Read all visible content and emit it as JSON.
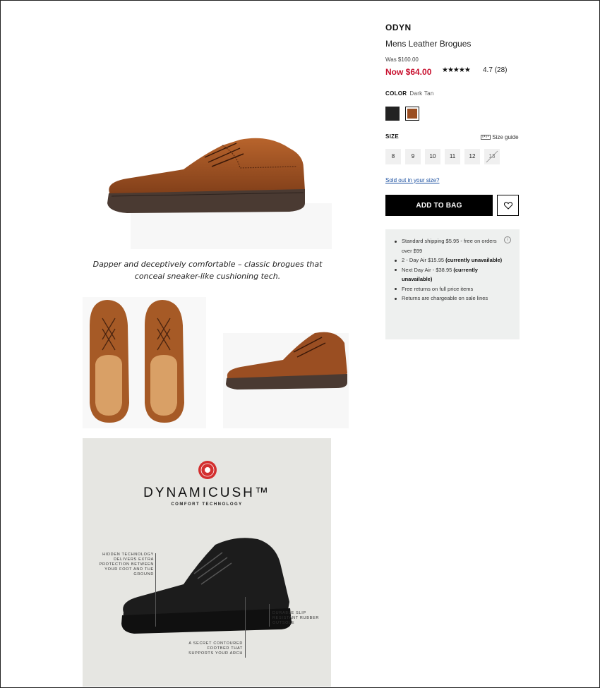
{
  "product": {
    "brand": "ODYN",
    "name": "Mens Leather Brogues",
    "was_price": "Was $160.00",
    "now_price": "Now $64.00",
    "rating_stars": "★★★★★",
    "rating": "4.7",
    "review_count": "(28)",
    "rating_value": 4.7
  },
  "color": {
    "label": "COLOR",
    "selected": "Dark Tan",
    "swatches": [
      {
        "name": "Black",
        "hex": "#222222"
      },
      {
        "name": "Dark Tan",
        "hex": "#9a4e22"
      }
    ]
  },
  "size": {
    "label": "SIZE",
    "guide": "Size guide",
    "options": [
      "8",
      "9",
      "10",
      "11",
      "12",
      "13"
    ],
    "unavailable": [
      "13"
    ]
  },
  "sold_out_link": "Sold out in your size?",
  "add_to_bag": "ADD TO BAG",
  "shipping": {
    "items": [
      {
        "text": "Standard shipping $5.95 - free on orders over $99",
        "bold": ""
      },
      {
        "text": "2 - Day Air $15.95 ",
        "bold": "(currently unavailable)"
      },
      {
        "text": "Next Day Air -  $38.95 ",
        "bold": "(currently unavailable)"
      },
      {
        "text": "Free returns on full price items",
        "bold": ""
      },
      {
        "text": "Returns are chargeable on sale lines",
        "bold": ""
      }
    ]
  },
  "tagline": "Dapper and deceptively comfortable – classic brogues that conceal sneaker-like cushioning tech.",
  "dynamicush": {
    "title": "DYNAMICUSH™",
    "subtitle": "COMFORT TECHNOLOGY",
    "note_left": "HIDDEN TECHNOLOGY DELIVERS EXTRA PROTECTION BETWEEN YOUR FOOT AND THE GROUND",
    "note_right": "DURABLE SLIP RESISTANT RUBBER OUTSOLE",
    "note_bottom": "A SECRET CONTOURED FOOTBED THAT SUPPORTS YOUR ARCH"
  },
  "colors": {
    "sale_red": "#c8102e",
    "button_black": "#000000",
    "link_blue": "#1a4fa0",
    "shipping_bg": "#eef0ef",
    "shoe_tan": "#9a4e22"
  },
  "icons": [
    "heart-icon",
    "ruler-icon",
    "info-icon",
    "dynamicush-badge-icon"
  ]
}
